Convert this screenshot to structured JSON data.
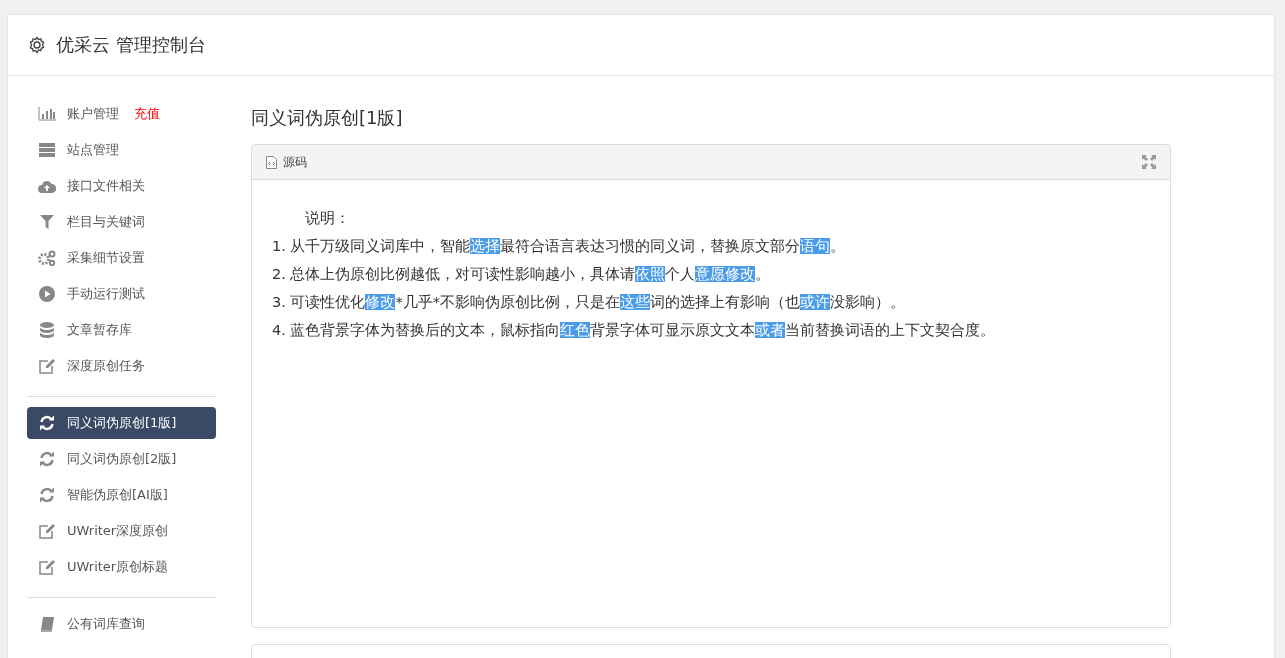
{
  "header": {
    "title": "优采云 管理控制台"
  },
  "sidebar": {
    "groups": [
      {
        "items": [
          {
            "label": "账户管理",
            "badge": "充值",
            "selected": false
          },
          {
            "label": "站点管理",
            "selected": false
          },
          {
            "label": "接口文件相关",
            "selected": false
          },
          {
            "label": "栏目与关键词",
            "selected": false
          },
          {
            "label": "采集细节设置",
            "selected": false
          },
          {
            "label": "手动运行测试",
            "selected": false
          },
          {
            "label": "文章暂存库",
            "selected": false
          },
          {
            "label": "深度原创任务",
            "selected": false
          }
        ]
      },
      {
        "items": [
          {
            "label": "同义词伪原创[1版]",
            "selected": true
          },
          {
            "label": "同义词伪原创[2版]",
            "selected": false
          },
          {
            "label": "智能伪原创[AI版]",
            "selected": false
          },
          {
            "label": "UWriter深度原创",
            "selected": false
          },
          {
            "label": "UWriter原创标题",
            "selected": false
          }
        ]
      },
      {
        "items": [
          {
            "label": "公有词库查询",
            "selected": false
          }
        ]
      }
    ]
  },
  "main": {
    "heading": "同义词伪原创[1版]",
    "editor": {
      "tab": "源码",
      "intro": "说明：",
      "lines": [
        [
          {
            "text": "1. 从千万级同义词库中，智能",
            "highlight": false
          },
          {
            "text": "选择",
            "highlight": true
          },
          {
            "text": "最符合语言表达习惯的同义词，替换原文部分",
            "highlight": false
          },
          {
            "text": "语句",
            "highlight": true
          },
          {
            "text": "。",
            "highlight": false
          }
        ],
        [
          {
            "text": "2. 总体上伪原创比例越低，对可读性影响越小，具体请",
            "highlight": false
          },
          {
            "text": "依照",
            "highlight": true
          },
          {
            "text": "个人",
            "highlight": false
          },
          {
            "text": "意愿",
            "highlight": true
          },
          {
            "text": "修改",
            "highlight": true
          },
          {
            "text": "。",
            "highlight": false
          }
        ],
        [
          {
            "text": "3. 可读性优化",
            "highlight": false
          },
          {
            "text": "修改",
            "highlight": true
          },
          {
            "text": "*几乎*不影响伪原创比例，只是在",
            "highlight": false
          },
          {
            "text": "这些",
            "highlight": true
          },
          {
            "text": "词的选择上有影响（也",
            "highlight": false
          },
          {
            "text": "或许",
            "highlight": true
          },
          {
            "text": "没影响）。",
            "highlight": false
          }
        ],
        [
          {
            "text": "4. 蓝色背景字体为替换后的文本，鼠标指向",
            "highlight": false
          },
          {
            "text": "红色",
            "highlight": true
          },
          {
            "text": "背景字体可显示原文文本",
            "highlight": false
          },
          {
            "text": "或者",
            "highlight": true
          },
          {
            "text": "当前替换词语的上下文契合度。",
            "highlight": false
          }
        ]
      ]
    }
  }
}
